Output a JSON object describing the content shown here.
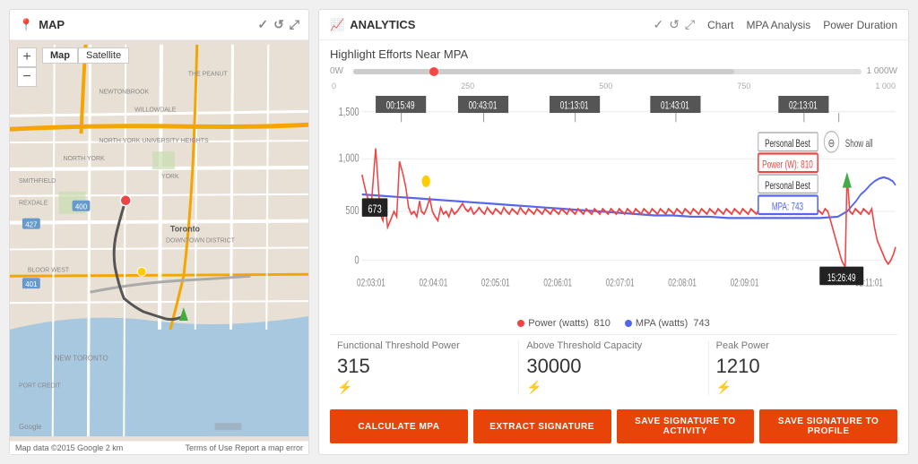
{
  "map": {
    "title": "MAP",
    "pin_icon": "📍",
    "map_type_buttons": [
      "Map",
      "Satellite"
    ],
    "active_map_type": "Map",
    "zoom_in": "+",
    "zoom_out": "−",
    "footer_left": "Map data ©2015 Google  2 km",
    "footer_right": "Terms of Use  Report a map error",
    "header_icons": [
      "✓",
      "↺",
      "⤢"
    ]
  },
  "analytics": {
    "title": "ANALYTICS",
    "title_icon": "📊",
    "header_icons": [
      "✓",
      "↺",
      "⤢"
    ],
    "nav_links": [
      "Chart",
      "MPA Analysis",
      "Power Duration"
    ],
    "active_nav": "Chart",
    "chart_title": "Highlight Efforts Near MPA",
    "slider": {
      "left_label": "0W",
      "right_label": "1 000W",
      "time_labels": [
        "0",
        "250",
        "500",
        "750",
        "1 000"
      ]
    },
    "time_axis": [
      "02:03:01",
      "02:04:01",
      "02:05:01",
      "02:06:01",
      "02:07:01",
      "02:08:01",
      "02:09:01",
      "15:26:49",
      "02:11:01"
    ],
    "effort_times": [
      "00:15:49",
      "00:43:01",
      "01:13:01",
      "01:43:01",
      "02:13:01"
    ],
    "y_axis": [
      "1,500",
      "1,000",
      "500",
      "0"
    ],
    "tooltips": {
      "personal_best_1": "Personal Best",
      "power_label": "Power (W):",
      "power_value": "810",
      "personal_best_2": "Personal Best",
      "mpa_label": "MPA:",
      "mpa_value": "743",
      "power_badge": "673",
      "time_badge": "15:26:49",
      "show_all": "Show all"
    },
    "legend": {
      "power_label": "Power (watts)",
      "power_value": "810",
      "mpa_label": "MPA (watts)",
      "mpa_value": "743",
      "power_color": "#e44",
      "mpa_color": "#44f"
    },
    "metrics": [
      {
        "label": "Functional Threshold Power",
        "value": "315",
        "edit_icon": "⚡"
      },
      {
        "label": "Above Threshold Capacity",
        "value": "30000",
        "edit_icon": "⚡"
      },
      {
        "label": "Peak Power",
        "value": "1210",
        "edit_icon": "⚡"
      }
    ],
    "buttons": [
      "CALCULATE MPA",
      "EXTRACT SIGNATURE",
      "SAVE SIGNATURE TO ACTIVITY",
      "SAVE SIGNATURE TO PROFILE"
    ]
  }
}
